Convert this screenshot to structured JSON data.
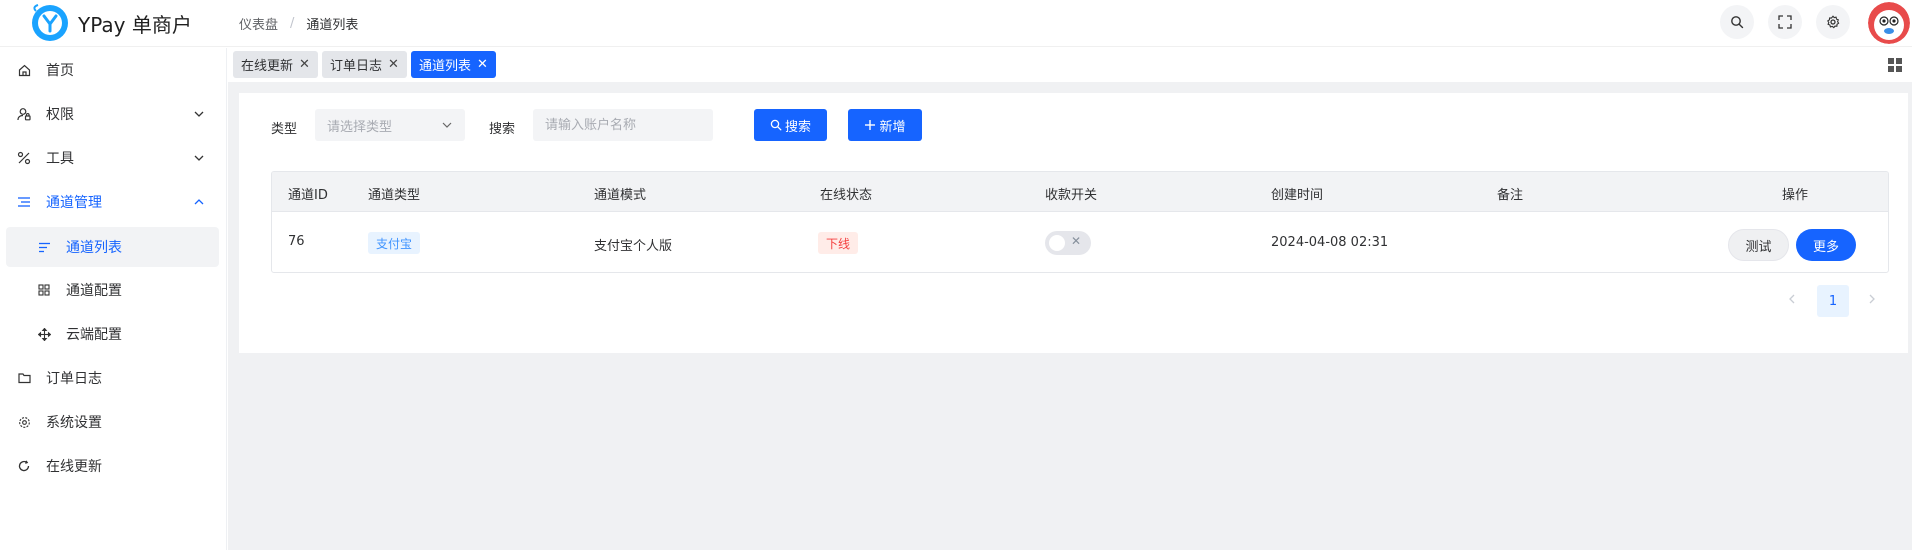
{
  "app": {
    "title": "YPay 单商户"
  },
  "breadcrumb": [
    "仪表盘",
    "通道列表"
  ],
  "header_actions": [
    "search-icon",
    "fullscreen-icon",
    "gear-icon",
    "avatar"
  ],
  "sidebar": {
    "items": [
      {
        "label": "首页",
        "icon": "home-icon"
      },
      {
        "label": "权限",
        "icon": "user-lock-icon",
        "expandable": true
      },
      {
        "label": "工具",
        "icon": "tools-icon",
        "expandable": true
      },
      {
        "label": "通道管理",
        "icon": "list-icon",
        "expandable": true,
        "expanded": true
      },
      {
        "label": "通道列表",
        "icon": "lines-icon",
        "active": true
      },
      {
        "label": "通道配置",
        "icon": "grid-icon"
      },
      {
        "label": "云端配置",
        "icon": "move-icon"
      },
      {
        "label": "订单日志",
        "icon": "folder-icon"
      },
      {
        "label": "系统设置",
        "icon": "gear-icon"
      },
      {
        "label": "在线更新",
        "icon": "refresh-icon"
      }
    ]
  },
  "tabs": [
    {
      "label": "在线更新",
      "active": false
    },
    {
      "label": "订单日志",
      "active": false
    },
    {
      "label": "通道列表",
      "active": true
    }
  ],
  "filters": {
    "type_label": "类型",
    "type_placeholder": "请选择类型",
    "search_label": "搜索",
    "search_placeholder": "请输入账户名称",
    "search_button": "搜索",
    "add_button": "新增"
  },
  "table": {
    "columns": [
      "通道ID",
      "通道类型",
      "通道模式",
      "在线状态",
      "收款开关",
      "创建时间",
      "备注",
      "操作"
    ],
    "rows": [
      {
        "id": "76",
        "type": "支付宝",
        "mode": "支付宝个人版",
        "status": "下线",
        "switch_on": false,
        "created": "2024-04-08 02:31",
        "remark": "",
        "actions": [
          "测试",
          "更多"
        ]
      }
    ]
  },
  "pagination": {
    "current": "1"
  },
  "colors": {
    "primary": "#1664ff",
    "sidebar_active": "#1664ff",
    "status_offline": "#f53f3f",
    "tag_alipay": "#4094ff"
  }
}
